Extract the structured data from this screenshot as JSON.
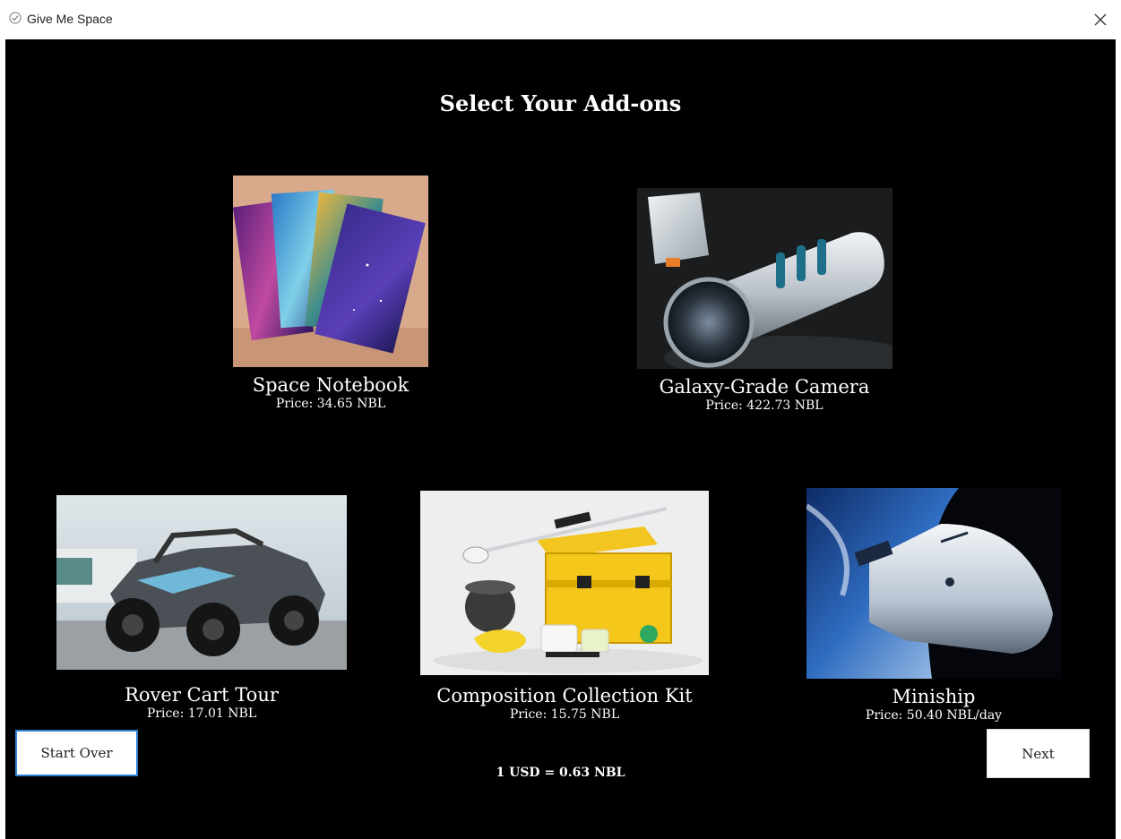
{
  "window": {
    "title": "Give Me Space",
    "icons": {
      "app": "checkmark-circle-icon",
      "close": "close-icon"
    }
  },
  "page": {
    "title": "Select Your Add-ons"
  },
  "products": [
    {
      "name": "Space Notebook",
      "price": "Price: 34.65 NBL",
      "image": "space-notebooks-photo"
    },
    {
      "name": "Galaxy-Grade Camera",
      "price": "Price: 422.73 NBL",
      "image": "camera-photo"
    },
    {
      "name": "Rover Cart Tour",
      "price": "Price: 17.01 NBL",
      "image": "rover-photo"
    },
    {
      "name": "Composition Collection Kit",
      "price": "Price: 15.75 NBL",
      "image": "collection-kit-photo"
    },
    {
      "name": "Miniship",
      "price": "Price: 50.40 NBL/day",
      "image": "miniship-photo"
    }
  ],
  "buttons": {
    "start_over": "Start Over",
    "next": "Next"
  },
  "footer": {
    "exchange_rate": "1 USD = 0.63 NBL"
  },
  "colors": {
    "background": "#000000",
    "text": "#ffffff",
    "focus_border": "#2f7fd6"
  }
}
